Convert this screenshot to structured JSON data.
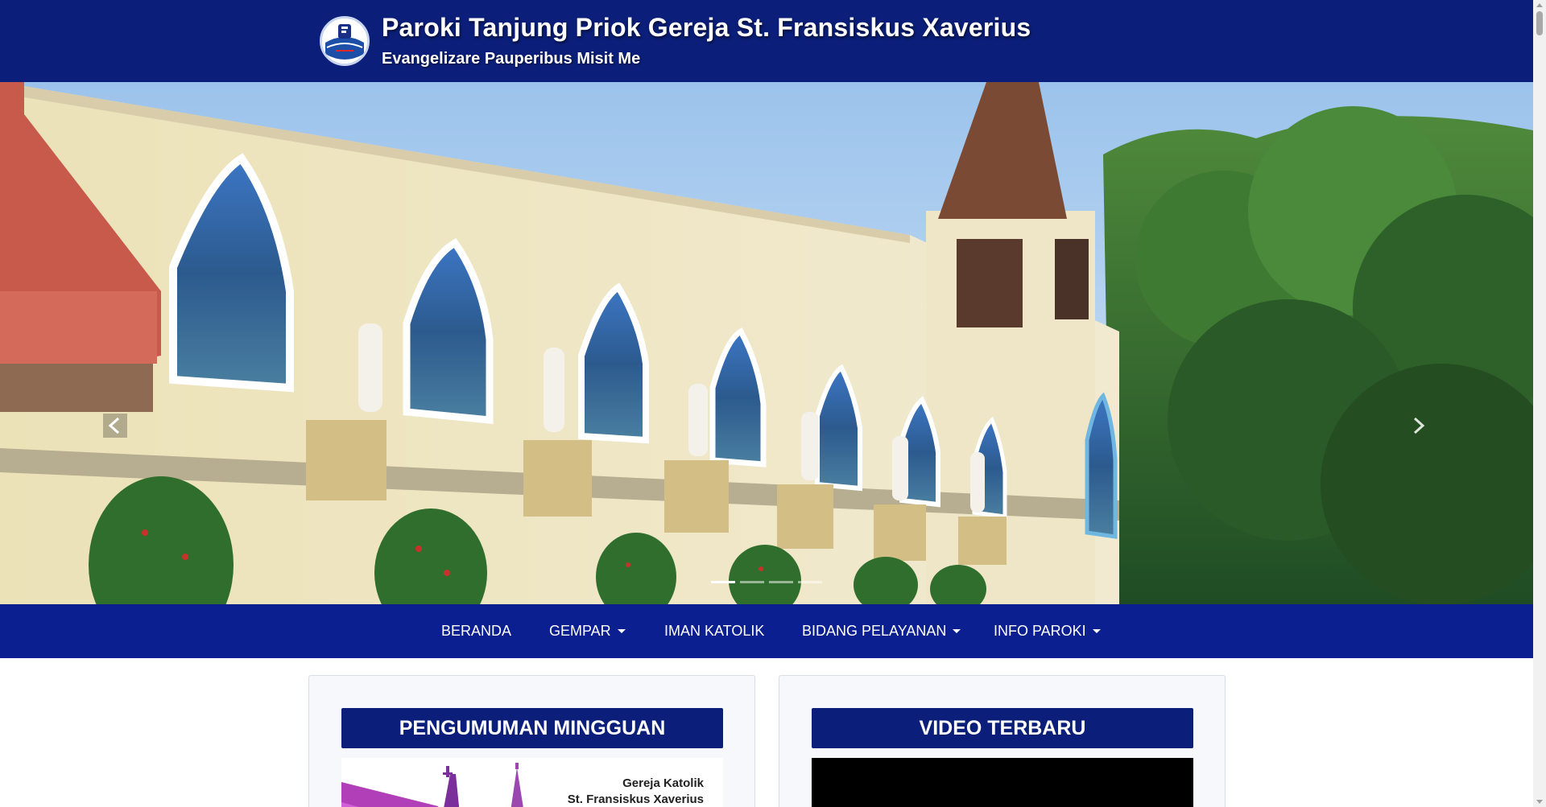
{
  "header": {
    "title": "Paroki Tanjung Priok Gereja St. Fransiskus Xaverius",
    "tagline": "Evangelizare Pauperibus Misit Me",
    "logo_icon": "parish-logo-icon"
  },
  "carousel": {
    "image_description": "church-building-photo",
    "prev_icon": "chevron-left-icon",
    "next_icon": "chevron-right-icon",
    "slide_count": 4,
    "active_slide": 1
  },
  "nav": {
    "items": [
      {
        "label": "BERANDA",
        "dropdown": false
      },
      {
        "label": "GEMPAR",
        "dropdown": true
      },
      {
        "label": "IMAN KATOLIK",
        "dropdown": false
      },
      {
        "label": "BIDANG PELAYANAN",
        "dropdown": true
      },
      {
        "label": "INFO PAROKI",
        "dropdown": true
      }
    ]
  },
  "cards": {
    "announcement": {
      "heading": "PENGUMUMAN MINGGUAN",
      "image_line1": "Gereja Katolik",
      "image_line2": "St. Fransiskus Xaverius"
    },
    "video": {
      "heading": "VIDEO TERBARU"
    }
  },
  "colors": {
    "header_bg": "#0b1f7a",
    "nav_bg": "#0b1f91",
    "card_heading_bg": "#0b1f7a"
  }
}
